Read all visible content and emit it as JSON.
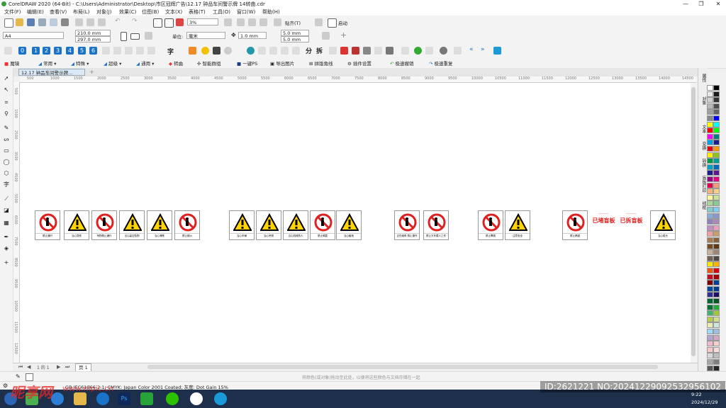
{
  "title": "CorelDRAW 2020 (64-Bit) - C:\\Users\\Administrator\\Desktop\\市区冠辉广告\\12.17 钟品车间警示牌 14转曲.cdr",
  "menu": [
    "文件(F)",
    "编辑(E)",
    "查看(V)",
    "布局(L)",
    "对象(J)",
    "效果(C)",
    "位图(B)",
    "文本(X)",
    "表格(T)",
    "工具(O)",
    "窗口(W)",
    "帮助(H)"
  ],
  "toolbar1": {
    "zoom": "3%",
    "snap_label": "贴齐(T)",
    "launch_label": "启动"
  },
  "toolbar2": {
    "page_size": "A4",
    "width": "210.0 mm",
    "height": "297.0 mm",
    "unit_label": "单位:",
    "unit_value": "毫米",
    "nudge": "1.0 mm",
    "dup_x": "5.0 mm",
    "dup_y": "5.0 mm"
  },
  "toolbar3_numbers": [
    "0",
    "1",
    "2",
    "3",
    "4",
    "5",
    "6"
  ],
  "toolbar3_chars": [
    "字",
    "分",
    "拆"
  ],
  "plugin_bar": [
    "魔镜",
    "常用",
    "特殊",
    "超级",
    "通用",
    "转曲",
    "智能群组",
    "一键PS",
    "导出图片",
    "拼版角线",
    "插件设置",
    "极速撤销",
    "极速重复"
  ],
  "doc_tab": "12.17 钟品车间警示牌...",
  "ruler_ticks": [
    "500",
    "1000",
    "1500",
    "2000",
    "2500",
    "3000",
    "3500",
    "4000",
    "4500",
    "5000",
    "5500",
    "6000",
    "6500",
    "7000",
    "7500",
    "8000",
    "8500",
    "9000",
    "9500",
    "10000",
    "10500",
    "11000",
    "11500",
    "12000",
    "12500",
    "13000",
    "13500",
    "14000",
    "14500"
  ],
  "vruler_ticks": [
    "500",
    "1000",
    "1500",
    "2000",
    "2500",
    "3000",
    "3500",
    "4000",
    "4500",
    "5000",
    "5500",
    "6000",
    "6500",
    "7000",
    "7500",
    "8000",
    "8500",
    "9000",
    "9500",
    "10000",
    "10500",
    "11000",
    "11500",
    "12000",
    "12500",
    "13000"
  ],
  "signs": [
    {
      "type": "prohibit",
      "caption": "禁止通行"
    },
    {
      "type": "warning",
      "caption": "当心烫伤"
    },
    {
      "type": "prohibit",
      "caption": "吊物禁止通行"
    },
    {
      "type": "warning",
      "caption": "当心高空坠物"
    },
    {
      "type": "warning",
      "caption": "当心滑跌"
    },
    {
      "type": "prohibit",
      "caption": "禁止烟火"
    },
    {
      "type": "warning",
      "caption": "当心车辆"
    },
    {
      "type": "warning",
      "caption": "当心吊物"
    },
    {
      "type": "warning",
      "caption": "当心机械伤人"
    },
    {
      "type": "prohibit",
      "caption": "禁止倚靠"
    },
    {
      "type": "warning",
      "caption": "当心触电"
    },
    {
      "type": "prohibit",
      "caption": "正在维修 禁止操作"
    },
    {
      "type": "prohibit",
      "caption": "禁止叉车载人工作"
    },
    {
      "type": "prohibit",
      "caption": "禁止攀爬"
    },
    {
      "type": "warning",
      "caption": "注意安全"
    },
    {
      "type": "prohibit",
      "caption": "禁止跨越"
    },
    {
      "type": "warning",
      "caption": "当心碰头"
    }
  ],
  "boards": [
    "已堵盲板",
    "已拆盲板"
  ],
  "docker_tabs": [
    "属性",
    "对象",
    "文本",
    "变换",
    "转换",
    "盲板打印",
    "线框"
  ],
  "page_tab": "页 1",
  "status_hint": "将颜色(或对象)拖动至此处，以便将这些颜色与文档存储在一起",
  "status_color": "GB IEC61966-2.1; CMYK: Japan Color 2001 Coated; 灰度: Dot Gain 15%",
  "clock_time": "9:22",
  "clock_date": "2024/12/29",
  "watermark": {
    "logo": "昵享网",
    "url": "www.nipic.cn",
    "id": "ID:2621221 NO:20241229092532956102"
  },
  "colors": {
    "prohibit": "#e02020",
    "warning_fill": "#ffd400",
    "accent": "#1a73c9"
  }
}
